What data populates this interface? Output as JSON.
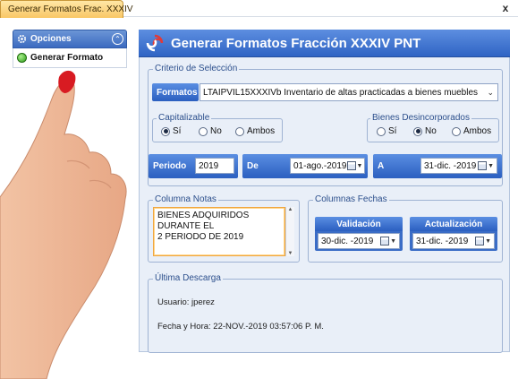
{
  "tab": {
    "title": "Generar Formatos Frac. XXXIV",
    "close_label": "x"
  },
  "nav": {
    "header_label": "Opciones",
    "collapse_icon": "chevron-up-icon",
    "items": [
      {
        "label": "Generar Formato",
        "icon": "green-dot-icon"
      }
    ]
  },
  "header": {
    "title": "Generar Formatos Fracción XXXIV PNT"
  },
  "criteria": {
    "legend": "Criterio de Selección",
    "formatos_label": "Formatos",
    "formatos_value": "LTAIPVIL15XXXIVb Inventario de altas practicadas a bienes muebles",
    "capitalizable": {
      "legend": "Capitalizable",
      "options": [
        "Sí",
        "No",
        "Ambos"
      ],
      "selected": "Sí"
    },
    "bienes": {
      "legend": "Bienes Desincorporados",
      "options": [
        "Sí",
        "No",
        "Ambos"
      ],
      "selected": "No"
    },
    "periodo_label": "Periodo",
    "periodo_value": "2019",
    "de_label": "De",
    "de_value": "01-ago.-2019",
    "a_label": "A",
    "a_value": "31-dic. -2019"
  },
  "notes": {
    "legend": "Columna Notas",
    "value": "BIENES ADQUIRIDOS DURANTE EL\n2 PERIODO DE 2019"
  },
  "fechas": {
    "legend": "Columnas Fechas",
    "validacion_label": "Validación",
    "validacion_value": "30-dic. -2019",
    "actualizacion_label": "Actualización",
    "actualizacion_value": "31-dic. -2019"
  },
  "last_download": {
    "legend": "Última Descarga",
    "user_line": "Usuario: jperez",
    "datetime_line": "Fecha y Hora: 22-NOV.-2019 03:57:06 P. M."
  },
  "colors": {
    "header_blue": "#2f64c4",
    "tab_orange": "#f9c766",
    "panel_bg": "#e9eff8",
    "notes_border": "#f0a640"
  }
}
